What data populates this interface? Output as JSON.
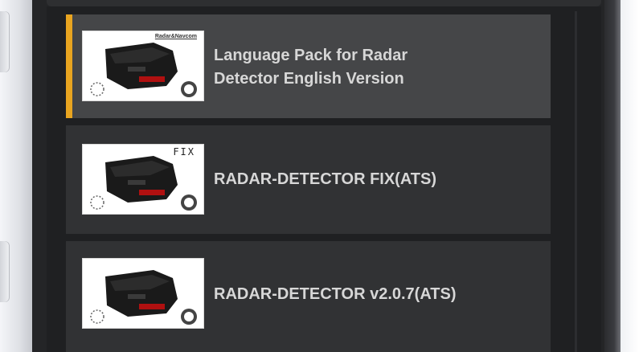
{
  "mods": [
    {
      "title_line1": "Language Pack for Radar",
      "title_line2": "Detector English Version",
      "selected": true,
      "thumb_tag": "Radar&Navcom",
      "thumb_icon": "radar-detector-image"
    },
    {
      "title": "RADAR-DETECTOR FIX(ATS)",
      "selected": false,
      "thumb_tag": "FIX",
      "thumb_icon": "radar-detector-image"
    },
    {
      "title": "RADAR-DETECTOR v2.0.7(ATS)",
      "selected": false,
      "thumb_tag": "",
      "thumb_icon": "radar-detector-image"
    }
  ],
  "colors": {
    "accent": "#e9a520",
    "card": "#313234",
    "card_selected": "#454648",
    "text": "#d7d7d7"
  }
}
